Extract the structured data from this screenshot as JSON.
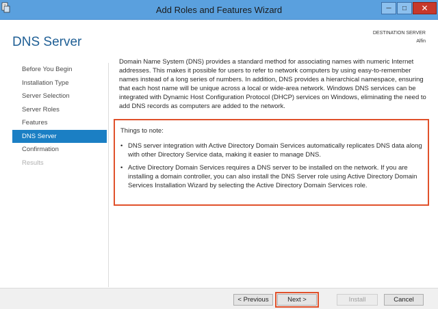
{
  "window": {
    "title": "Add Roles and Features Wizard",
    "minimize_icon": "minimize-icon",
    "maximize_icon": "maximize-icon",
    "close_icon": "close-icon"
  },
  "header": {
    "page_title": "DNS Server",
    "destination_label": "DESTINATION SERVER",
    "destination_name": "Alfin"
  },
  "nav": {
    "items": [
      {
        "label": "Before You Begin",
        "state": "normal"
      },
      {
        "label": "Installation Type",
        "state": "normal"
      },
      {
        "label": "Server Selection",
        "state": "normal"
      },
      {
        "label": "Server Roles",
        "state": "normal"
      },
      {
        "label": "Features",
        "state": "normal"
      },
      {
        "label": "DNS Server",
        "state": "active"
      },
      {
        "label": "Confirmation",
        "state": "normal"
      },
      {
        "label": "Results",
        "state": "disabled"
      }
    ]
  },
  "main": {
    "description": "Domain Name System (DNS) provides a standard method for associating names with numeric Internet addresses. This makes it possible for users to refer to network computers by using easy-to-remember names instead of a long series of numbers. In addition, DNS provides a hierarchical namespace, ensuring that each host name will be unique across a local or wide-area network. Windows DNS services can be integrated with Dynamic Host Configuration Protocol (DHCP) services on Windows, eliminating the need to add DNS records as computers are added to the network.",
    "notes_heading": "Things to note:",
    "notes": [
      "DNS server integration with Active Directory Domain Services automatically replicates DNS data along with other Directory Service data, making it easier to manage DNS.",
      "Active Directory Domain Services requires a DNS server to be installed on the network. If you are installing a domain controller, you can also install the DNS Server role using Active Directory Domain Services Installation Wizard by selecting the Active Directory Domain Services role."
    ],
    "bullet": "•"
  },
  "footer": {
    "previous_label": "< Previous",
    "next_label": "Next >",
    "install_label": "Install",
    "cancel_label": "Cancel"
  },
  "colors": {
    "title_bar": "#5aa0de",
    "accent": "#1b7fc4",
    "page_title": "#1f5f95",
    "highlight": "#e0502a",
    "close_button": "#c7382b"
  }
}
